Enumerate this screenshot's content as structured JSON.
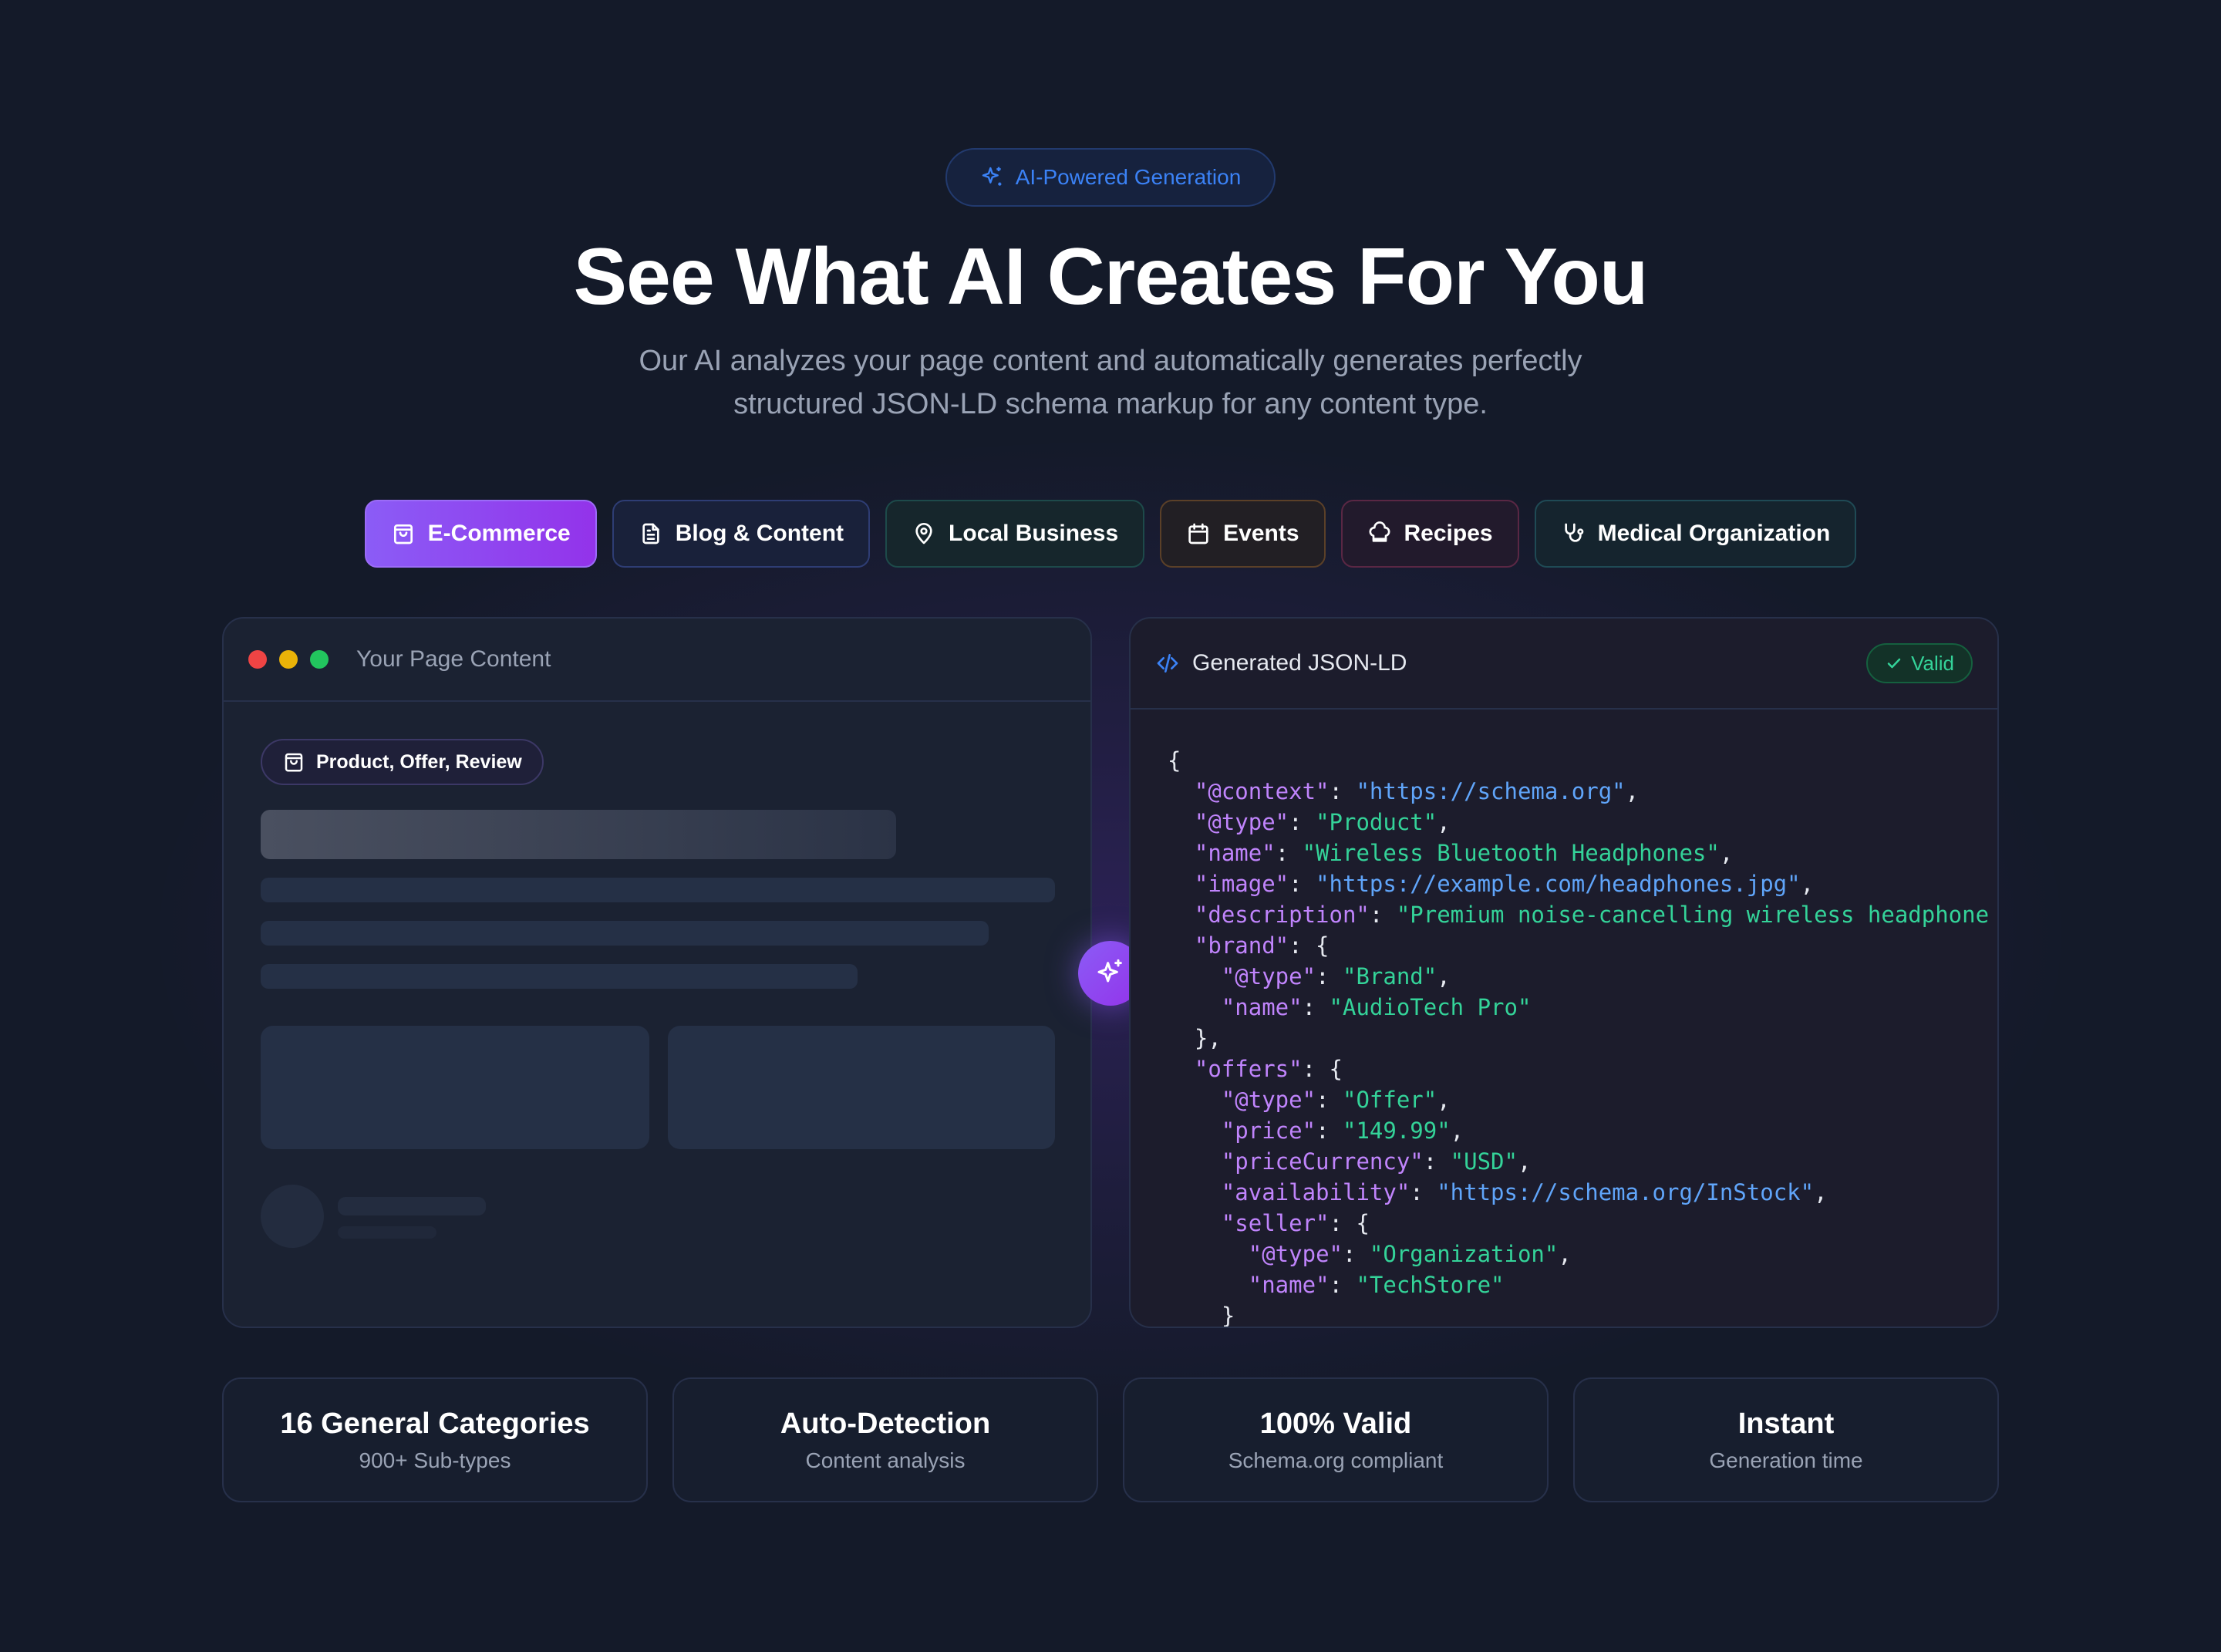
{
  "badge": {
    "icon": "sparkles-icon",
    "label": "AI-Powered Generation"
  },
  "hero": {
    "title": "See What AI Creates For You",
    "subtitle_line1": "Our AI analyzes your page content and automatically generates perfectly",
    "subtitle_line2": "structured JSON-LD schema markup for any content type."
  },
  "tabs": [
    {
      "label": "E-Commerce",
      "icon": "shopping-bag-icon",
      "active": true
    },
    {
      "label": "Blog & Content",
      "icon": "document-icon"
    },
    {
      "label": "Local Business",
      "icon": "map-pin-icon"
    },
    {
      "label": "Events",
      "icon": "calendar-icon"
    },
    {
      "label": "Recipes",
      "icon": "chef-hat-icon"
    },
    {
      "label": "Medical Organization",
      "icon": "stethoscope-icon"
    }
  ],
  "content_panel": {
    "title": "Your Page Content",
    "chip_label": "Product, Offer, Review"
  },
  "json_panel": {
    "title": "Generated JSON-LD",
    "status": "Valid",
    "code_lines": [
      [
        [
          "p",
          "{"
        ]
      ],
      [
        [
          "p",
          "  "
        ],
        [
          "k",
          "\"@context\""
        ],
        [
          "p",
          ": "
        ],
        [
          "u",
          "\"https://schema.org\""
        ],
        [
          "p",
          ","
        ]
      ],
      [
        [
          "p",
          "  "
        ],
        [
          "k",
          "\"@type\""
        ],
        [
          "p",
          ": "
        ],
        [
          "s",
          "\"Product\""
        ],
        [
          "p",
          ","
        ]
      ],
      [
        [
          "p",
          "  "
        ],
        [
          "k",
          "\"name\""
        ],
        [
          "p",
          ": "
        ],
        [
          "s",
          "\"Wireless Bluetooth Headphones\""
        ],
        [
          "p",
          ","
        ]
      ],
      [
        [
          "p",
          "  "
        ],
        [
          "k",
          "\"image\""
        ],
        [
          "p",
          ": "
        ],
        [
          "u",
          "\"https://example.com/headphones.jpg\""
        ],
        [
          "p",
          ","
        ]
      ],
      [
        [
          "p",
          "  "
        ],
        [
          "k",
          "\"description\""
        ],
        [
          "p",
          ": "
        ],
        [
          "s",
          "\"Premium noise-cancelling wireless headphone"
        ]
      ],
      [
        [
          "p",
          "  "
        ],
        [
          "k",
          "\"brand\""
        ],
        [
          "p",
          ": {"
        ]
      ],
      [
        [
          "p",
          "    "
        ],
        [
          "k",
          "\"@type\""
        ],
        [
          "p",
          ": "
        ],
        [
          "s",
          "\"Brand\""
        ],
        [
          "p",
          ","
        ]
      ],
      [
        [
          "p",
          "    "
        ],
        [
          "k",
          "\"name\""
        ],
        [
          "p",
          ": "
        ],
        [
          "s",
          "\"AudioTech Pro\""
        ]
      ],
      [
        [
          "p",
          "  },"
        ]
      ],
      [
        [
          "p",
          "  "
        ],
        [
          "k",
          "\"offers\""
        ],
        [
          "p",
          ": {"
        ]
      ],
      [
        [
          "p",
          "    "
        ],
        [
          "k",
          "\"@type\""
        ],
        [
          "p",
          ": "
        ],
        [
          "s",
          "\"Offer\""
        ],
        [
          "p",
          ","
        ]
      ],
      [
        [
          "p",
          "    "
        ],
        [
          "k",
          "\"price\""
        ],
        [
          "p",
          ": "
        ],
        [
          "s",
          "\"149.99\""
        ],
        [
          "p",
          ","
        ]
      ],
      [
        [
          "p",
          "    "
        ],
        [
          "k",
          "\"priceCurrency\""
        ],
        [
          "p",
          ": "
        ],
        [
          "s",
          "\"USD\""
        ],
        [
          "p",
          ","
        ]
      ],
      [
        [
          "p",
          "    "
        ],
        [
          "k",
          "\"availability\""
        ],
        [
          "p",
          ": "
        ],
        [
          "u",
          "\"https://schema.org/InStock\""
        ],
        [
          "p",
          ","
        ]
      ],
      [
        [
          "p",
          "    "
        ],
        [
          "k",
          "\"seller\""
        ],
        [
          "p",
          ": {"
        ]
      ],
      [
        [
          "p",
          "      "
        ],
        [
          "k",
          "\"@type\""
        ],
        [
          "p",
          ": "
        ],
        [
          "s",
          "\"Organization\""
        ],
        [
          "p",
          ","
        ]
      ],
      [
        [
          "p",
          "      "
        ],
        [
          "k",
          "\"name\""
        ],
        [
          "p",
          ": "
        ],
        [
          "s",
          "\"TechStore\""
        ]
      ],
      [
        [
          "p",
          "    }"
        ]
      ]
    ]
  },
  "stats": [
    {
      "value": "16 General Categories",
      "label": "900+ Sub-types"
    },
    {
      "value": "Auto-Detection",
      "label": "Content analysis"
    },
    {
      "value": "100% Valid",
      "label": "Schema.org compliant"
    },
    {
      "value": "Instant",
      "label": "Generation time"
    }
  ],
  "colors": {
    "background": "#141a29",
    "accent_purple": "#8b5cf6",
    "accent_blue": "#3b82f6",
    "json_key": "#c084fc",
    "json_string": "#34d399",
    "json_url": "#60a5fa",
    "valid_green": "#34d399",
    "dot_red": "#ef4444",
    "dot_yellow": "#eab308",
    "dot_green": "#22c55e"
  }
}
